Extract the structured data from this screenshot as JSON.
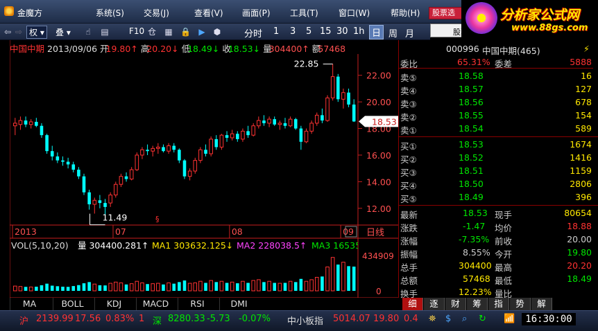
{
  "app": {
    "title": "金魔方"
  },
  "menu": [
    "系统(S)",
    "交易(J)",
    "查看(V)",
    "画面(P)",
    "工具(T)",
    "窗口(W)",
    "帮助(H)"
  ],
  "stock_input": "股票选",
  "query_box": "股票",
  "banner": {
    "title": "分析家公式网",
    "url": "www.88gs.com"
  },
  "toolbar": {
    "fuquan": "权",
    "overlay": "叠",
    "f10": "F10",
    "periods": [
      "分时",
      "1",
      "3",
      "5",
      "15",
      "30",
      "1h",
      "日",
      "周",
      "月"
    ],
    "active_period": "日"
  },
  "quote": {
    "name": "中国中期",
    "date": "2013/09/06",
    "open_label": "开",
    "open": "19.80↑",
    "high_label": "高",
    "high": "20.20↓",
    "low_label": "低",
    "low": "18.49↓",
    "close_label": "收",
    "close": "18.53↓",
    "vol_label": "量",
    "vol": "304400↑",
    "amt_label": "额",
    "amt": "57468"
  },
  "chart_data": {
    "type": "candlestick",
    "ylim": [
      11,
      23.6
    ],
    "y_ticks": [
      "22.00",
      "20.00",
      "18.00",
      "16.00",
      "14.00",
      "12.00"
    ],
    "x_labels": [
      "2013",
      "07",
      "08",
      "09"
    ],
    "max_label": "22.85",
    "min_label": "11.49",
    "current_price": "18.53",
    "period_label": "日线",
    "ohlc": [
      [
        18.2,
        18.8,
        17.5,
        18.4
      ],
      [
        18.3,
        18.9,
        17.9,
        18.6
      ],
      [
        18.6,
        18.9,
        18.1,
        18.3
      ],
      [
        18.3,
        18.7,
        18.0,
        18.5
      ],
      [
        18.5,
        18.8,
        18.1,
        18.2
      ],
      [
        18.2,
        18.4,
        17.3,
        17.5
      ],
      [
        17.5,
        17.6,
        16.1,
        16.3
      ],
      [
        16.3,
        16.7,
        15.6,
        15.9
      ],
      [
        15.9,
        16.2,
        15.4,
        15.6
      ],
      [
        15.6,
        15.9,
        15.2,
        15.5
      ],
      [
        15.5,
        15.8,
        15.0,
        15.3
      ],
      [
        15.3,
        15.5,
        14.7,
        14.9
      ],
      [
        14.9,
        15.1,
        14.2,
        14.4
      ],
      [
        14.4,
        14.6,
        13.0,
        13.2
      ],
      [
        13.2,
        13.4,
        11.9,
        12.3
      ],
      [
        12.3,
        12.8,
        11.6,
        12.6
      ],
      [
        12.6,
        13.0,
        12.0,
        12.4
      ],
      [
        12.4,
        12.7,
        11.49,
        12.1
      ],
      [
        12.4,
        13.2,
        12.1,
        13.0
      ],
      [
        13.0,
        14.0,
        12.8,
        13.8
      ],
      [
        13.8,
        14.6,
        13.6,
        14.4
      ],
      [
        14.4,
        14.7,
        14.0,
        14.2
      ],
      [
        14.2,
        15.1,
        14.1,
        14.9
      ],
      [
        14.9,
        16.2,
        14.8,
        16.0
      ],
      [
        16.0,
        16.6,
        15.7,
        16.4
      ],
      [
        16.4,
        16.8,
        16.0,
        16.3
      ],
      [
        16.3,
        16.7,
        15.9,
        16.5
      ],
      [
        16.5,
        16.9,
        16.1,
        16.6
      ],
      [
        16.6,
        16.8,
        16.2,
        16.3
      ],
      [
        16.3,
        16.9,
        16.1,
        16.7
      ],
      [
        16.7,
        16.9,
        16.2,
        16.4
      ],
      [
        16.4,
        16.5,
        15.4,
        15.6
      ],
      [
        15.6,
        15.7,
        14.2,
        14.4
      ],
      [
        14.4,
        15.0,
        14.1,
        14.8
      ],
      [
        14.8,
        15.8,
        14.6,
        15.6
      ],
      [
        15.6,
        16.6,
        15.4,
        16.4
      ],
      [
        16.4,
        16.8,
        15.9,
        16.1
      ],
      [
        16.1,
        17.4,
        15.9,
        17.2
      ],
      [
        17.2,
        17.5,
        16.4,
        16.6
      ],
      [
        16.6,
        17.6,
        16.4,
        17.5
      ],
      [
        17.5,
        17.8,
        17.0,
        17.3
      ],
      [
        17.3,
        17.9,
        17.1,
        17.6
      ],
      [
        17.6,
        17.8,
        17.0,
        17.2
      ],
      [
        17.2,
        18.0,
        17.0,
        17.8
      ],
      [
        17.8,
        18.2,
        17.3,
        17.5
      ],
      [
        17.5,
        18.4,
        17.4,
        18.2
      ],
      [
        18.2,
        18.9,
        18.0,
        18.6
      ],
      [
        18.6,
        19.0,
        18.2,
        18.4
      ],
      [
        18.4,
        18.9,
        18.1,
        18.7
      ],
      [
        18.7,
        18.9,
        18.2,
        18.3
      ],
      [
        18.3,
        18.6,
        17.9,
        18.4
      ],
      [
        18.4,
        18.8,
        18.0,
        18.2
      ],
      [
        18.2,
        18.9,
        18.1,
        18.7
      ],
      [
        18.7,
        18.8,
        17.9,
        18.0
      ],
      [
        18.0,
        18.2,
        16.4,
        17.0
      ],
      [
        17.0,
        18.0,
        16.9,
        17.8
      ],
      [
        17.8,
        18.6,
        17.6,
        18.4
      ],
      [
        18.4,
        19.2,
        18.2,
        19.0
      ],
      [
        19.0,
        19.5,
        18.4,
        18.6
      ],
      [
        18.6,
        20.5,
        18.5,
        20.3
      ],
      [
        20.3,
        22.85,
        20.1,
        21.9
      ],
      [
        21.9,
        22.1,
        20.0,
        20.2
      ],
      [
        20.2,
        21.0,
        19.5,
        20.7
      ],
      [
        20.7,
        21.0,
        19.6,
        19.8
      ],
      [
        19.8,
        20.2,
        18.49,
        18.53
      ]
    ],
    "volume": {
      "label": "VOL(5,10,20)",
      "vol_label": "量",
      "vol": "304400.281↑",
      "ma1_label": "MA1",
      "ma1": "303632.125↓",
      "ma2_label": "MA2",
      "ma2": "228038.5↑",
      "ma3_label": "MA3",
      "ma3": "165356",
      "ymax": 434909,
      "y_ticks": [
        "434909",
        "0"
      ],
      "values": [
        60000,
        55000,
        50000,
        48000,
        52000,
        70000,
        90000,
        65000,
        58000,
        52000,
        50000,
        60000,
        72000,
        95000,
        110000,
        85000,
        70000,
        68000,
        95000,
        110000,
        100000,
        80000,
        90000,
        120000,
        100000,
        85000,
        90000,
        95000,
        80000,
        100000,
        90000,
        110000,
        130000,
        95000,
        100000,
        120000,
        100000,
        130000,
        110000,
        120000,
        100000,
        110000,
        95000,
        120000,
        100000,
        130000,
        140000,
        110000,
        120000,
        100000,
        95000,
        100000,
        120000,
        110000,
        150000,
        120000,
        140000,
        170000,
        180000,
        300000,
        420000,
        330000,
        360000,
        310000,
        304400
      ]
    }
  },
  "indicator_tabs": [
    "MA",
    "BOLL",
    "KDJ",
    "MACD",
    "RSI",
    "DMI"
  ],
  "side_tabs": [
    "细",
    "逐",
    "财",
    "筹",
    "指",
    "势",
    "解"
  ],
  "panel": {
    "code": "000996",
    "name": "中国中期(465)",
    "wei_bi_label": "委比",
    "wei_bi": "65.31%",
    "wei_cha_label": "委差",
    "wei_cha": "5888",
    "sell": [
      {
        "label": "卖⑤",
        "price": "18.58",
        "vol": "16"
      },
      {
        "label": "卖④",
        "price": "18.57",
        "vol": "127"
      },
      {
        "label": "卖③",
        "price": "18.56",
        "vol": "678"
      },
      {
        "label": "卖②",
        "price": "18.55",
        "vol": "154"
      },
      {
        "label": "卖①",
        "price": "18.54",
        "vol": "589"
      }
    ],
    "buy": [
      {
        "label": "买①",
        "price": "18.53",
        "vol": "1674"
      },
      {
        "label": "买②",
        "price": "18.52",
        "vol": "1416"
      },
      {
        "label": "买③",
        "price": "18.51",
        "vol": "1159"
      },
      {
        "label": "买④",
        "price": "18.50",
        "vol": "2806"
      },
      {
        "label": "买⑤",
        "price": "18.49",
        "vol": "396"
      }
    ],
    "stats": [
      {
        "l1": "最新",
        "v1": "18.53",
        "l2": "现手",
        "v2": "80654"
      },
      {
        "l1": "涨跌",
        "v1": "-1.47",
        "l2": "均价",
        "v2": "18.88"
      },
      {
        "l1": "涨幅",
        "v1": "-7.35%",
        "l2": "前收",
        "v2": "20.00"
      },
      {
        "l1": "振幅",
        "v1": "8.55%",
        "l2": "今开",
        "v2": "19.80"
      },
      {
        "l1": "总手",
        "v1": "304400",
        "l2": "最高",
        "v2": "20.20"
      },
      {
        "l1": "总额",
        "v1": "57468",
        "l2": "最低",
        "v2": "18.49"
      },
      {
        "l1": "换手",
        "v1": "12.23%",
        "l2": "量比",
        "v2": ""
      }
    ]
  },
  "status": {
    "sh_label": "沪",
    "sh_index": "2139.99",
    "sh_chg": "17.56",
    "sh_pct": "0.83%",
    "sh_more": "1",
    "sz_label": "深",
    "sz_index": "8280.33",
    "sz_chg": "-5.73",
    "sz_pct": "-0.07%",
    "zx_label": "中小板指",
    "zx_index": "5014.07",
    "zx_chg": "19.80",
    "zx_pct": "0.4",
    "time": "16:30:00"
  },
  "colors": {
    "up": "#ff3232",
    "down": "#00ffff",
    "axis_red": "#c81e1e",
    "label_red": "#ff5050",
    "green": "#00e600"
  }
}
